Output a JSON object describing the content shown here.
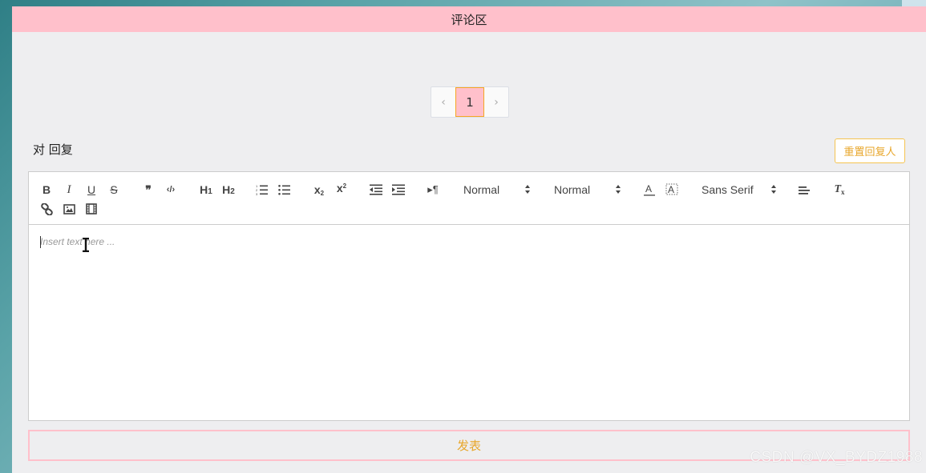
{
  "header": {
    "title": "评论区"
  },
  "pagination": {
    "prev": "‹",
    "current": "1",
    "next": "›"
  },
  "reply": {
    "label": "对 回复",
    "reset_button": "重置回复人"
  },
  "editor": {
    "toolbar": {
      "header_label": "H",
      "header1_sub": "1",
      "header2_sub": "2",
      "subscript_base": "x",
      "subscript_mark": "2",
      "superscript_base": "x",
      "superscript_mark": "2",
      "size_picker": "Normal",
      "header_picker": "Normal",
      "font_picker": "Sans Serif",
      "bold": "B",
      "italic": "I",
      "underline": "U",
      "strike": "S",
      "quote": "❞",
      "code": "‹/›",
      "rtl": "▸¶",
      "clean": "T",
      "clean_mark": "x"
    },
    "placeholder": "Insert text here ..."
  },
  "submit": {
    "label": "发表"
  },
  "watermark": "CSDN @VX_BYDZ1988",
  "colors": {
    "header_bg": "#ffc0cb",
    "accent": "#e8a72c",
    "panel_bg": "#eeeef0"
  }
}
